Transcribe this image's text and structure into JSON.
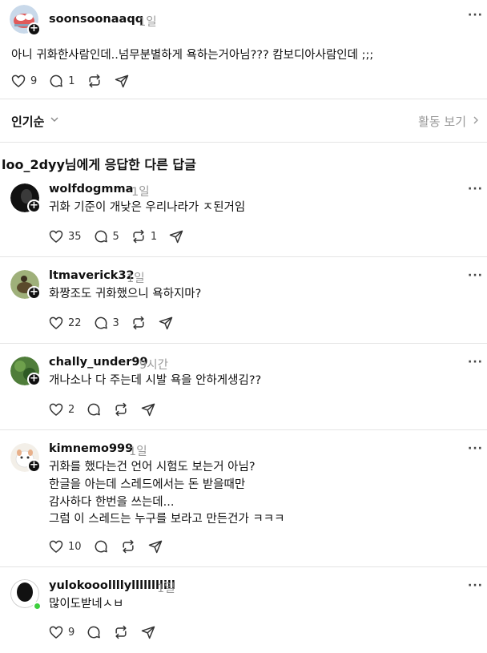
{
  "main_post": {
    "username": "soonsoonaaqq",
    "time": "1일",
    "text": "아니 귀화한사람인데..넘무분별하게 욕하는거아님??? 캄보디아사람인데 ;;;",
    "likes": "9",
    "replies": "1"
  },
  "sort": {
    "label": "인기순",
    "activity_label": "활동 보기"
  },
  "section_title": "loo_2dyy님에게 응답한 다른 답글",
  "replies": [
    {
      "username": "wolfdogmma",
      "time": "1일",
      "lines": [
        "귀화 기준이 개낮은 우리나라가 ㅈ된거임"
      ],
      "likes": "35",
      "comments": "5",
      "reposts": "1"
    },
    {
      "username": "ltmaverick32",
      "time": "1일",
      "lines": [
        "화짱조도 귀화했으니 욕하지마?"
      ],
      "likes": "22",
      "comments": "3"
    },
    {
      "username": "chally_under99",
      "time": "9시간",
      "lines": [
        "개나소나 다 주는데 시발 욕을 안하게생김??"
      ],
      "likes": "2"
    },
    {
      "username": "kimnemo999",
      "time": "1일",
      "lines": [
        "귀화를 했다는건 언어 시험도 보는거 아님?",
        "한글을 아는데 스레드에서는 돈 받을때만",
        "감사하다 한번을 쓰는데...",
        "그럼 이 스레드는 누구를 보라고 만든건가 ㅋㅋㅋ"
      ],
      "likes": "10"
    },
    {
      "username": "yulokooollllyllllllllill",
      "time": "1일",
      "lines": [
        "많이도받네ㅅㅂ"
      ],
      "likes": "9"
    }
  ],
  "colors": {
    "text": "#101010",
    "muted": "#999999",
    "divider": "#e4e4e4",
    "online": "#3ecf3e"
  }
}
